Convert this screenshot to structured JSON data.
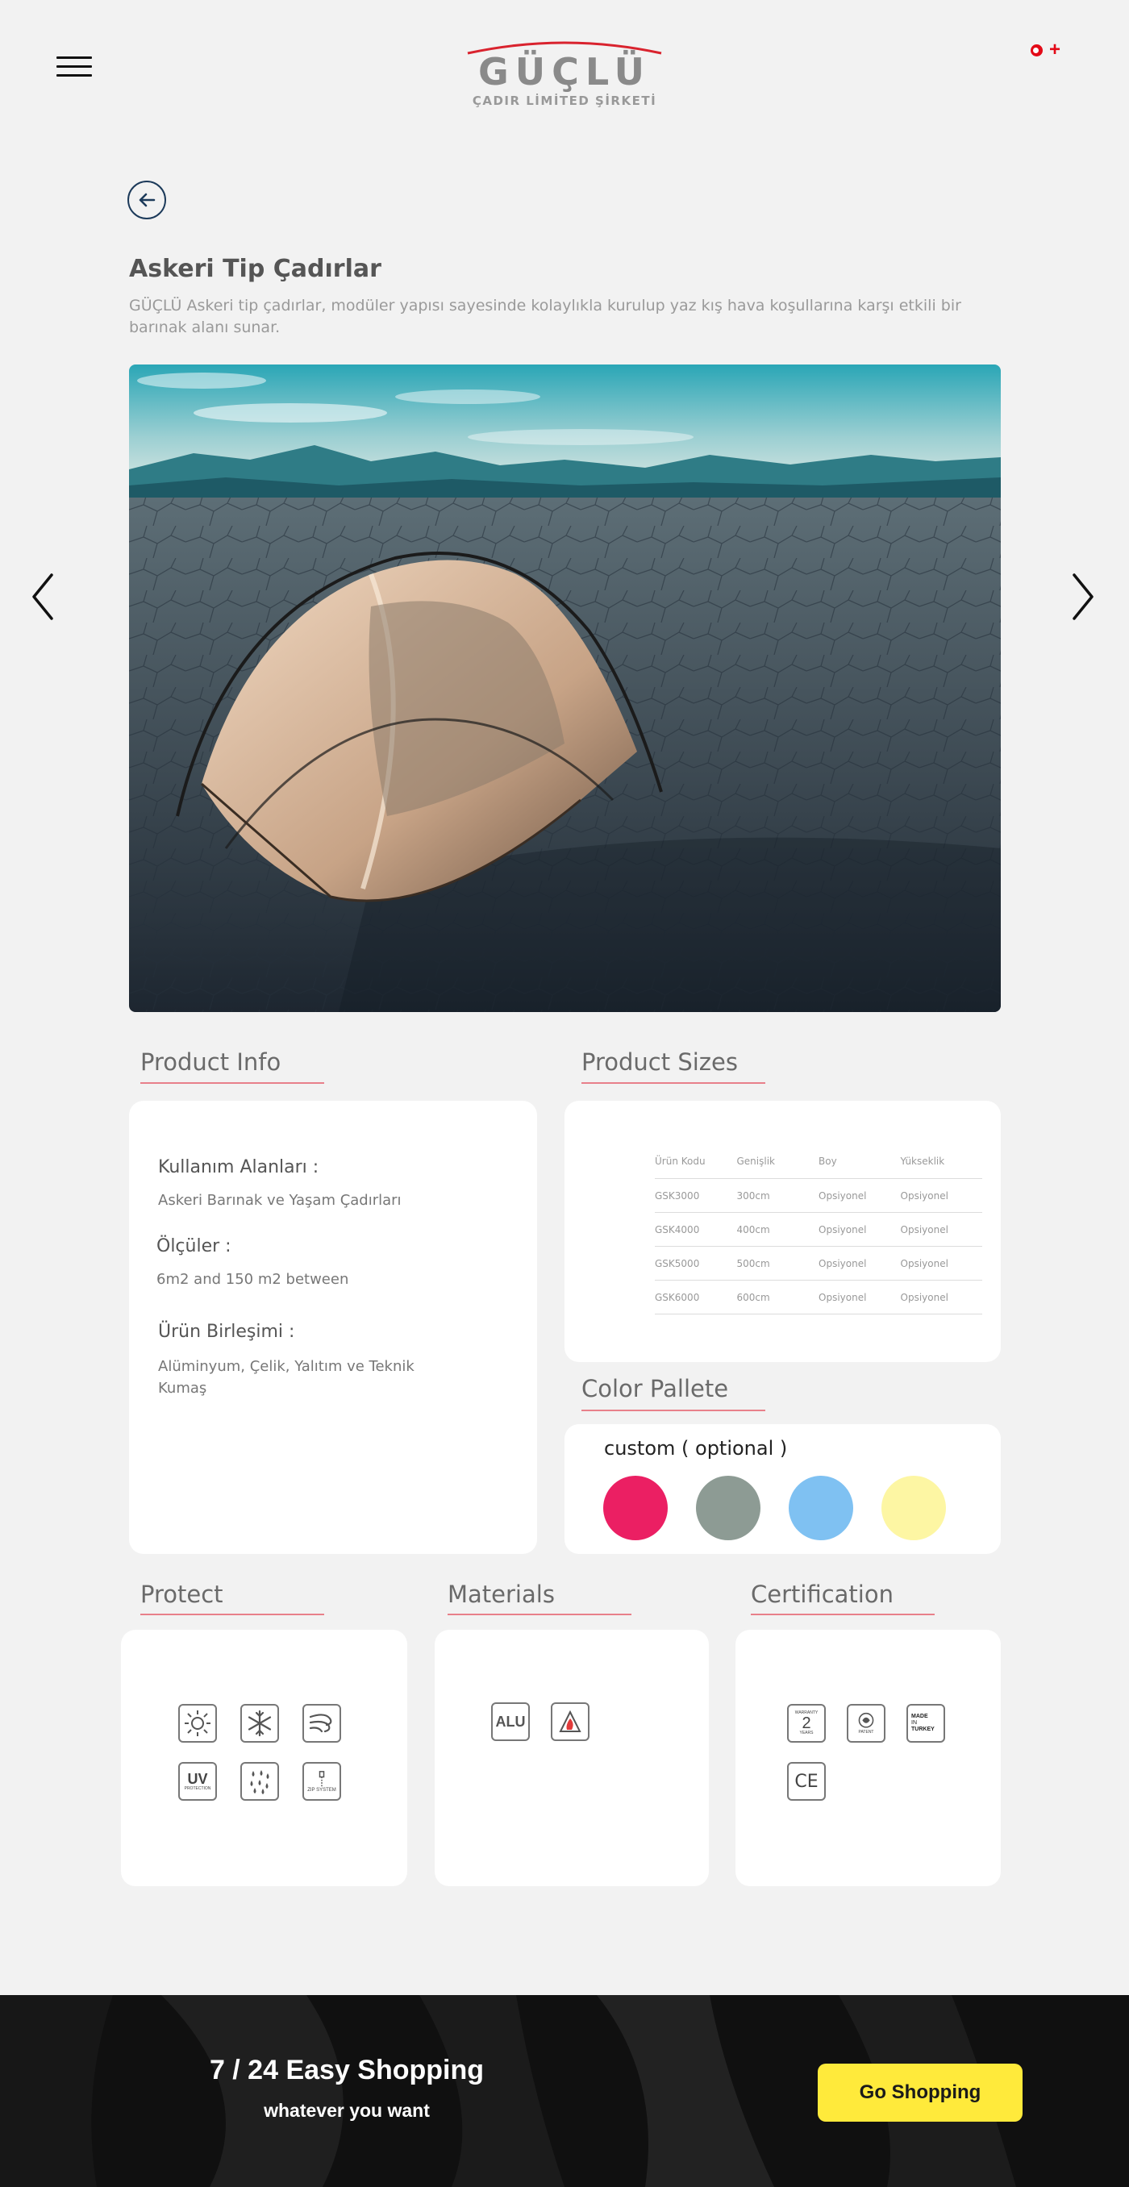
{
  "header": {
    "logo_text": "GÜÇLÜ",
    "logo_subtitle": "ÇADIR LİMİTED ŞİRKETİ"
  },
  "product": {
    "title": "Askeri Tip Çadırlar",
    "description": "GÜÇLÜ Askeri tip çadırlar, modüler yapısı sayesinde kolaylıkla kurulup yaz kış hava koşullarına karşı etkili bir barınak alanı sunar."
  },
  "product_info": {
    "heading": "Product Info",
    "usage_label": "Kullanım Alanları :",
    "usage_value": "Askeri Barınak ve Yaşam Çadırları",
    "size_label": "Ölçüler :",
    "size_value": "6m2 and 150 m2 between",
    "composition_label": "Ürün Birleşimi :",
    "composition_value": "Alüminyum, Çelik, Yalıtım ve Teknik Kumaş"
  },
  "product_sizes": {
    "heading": "Product Sizes",
    "columns": [
      "Ürün Kodu",
      "Genişlik",
      "Boy",
      "Yükseklik"
    ],
    "rows": [
      [
        "GSK3000",
        "300cm",
        "Opsiyonel",
        "Opsiyonel"
      ],
      [
        "GSK4000",
        "400cm",
        "Opsiyonel",
        "Opsiyonel"
      ],
      [
        "GSK5000",
        "500cm",
        "Opsiyonel",
        "Opsiyonel"
      ],
      [
        "GSK6000",
        "600cm",
        "Opsiyonel",
        "Opsiyonel"
      ]
    ]
  },
  "color_palette": {
    "heading": "Color Pallete",
    "caption": "custom ( optional )",
    "colors": [
      "#eb1f63",
      "#8d9b94",
      "#7fc1f2",
      "#fdf6a3"
    ]
  },
  "protect": {
    "heading": "Protect",
    "icons": [
      "sun-icon",
      "snowflake-icon",
      "wind-icon",
      "uv-protection-icon",
      "rain-drops-icon",
      "zip-system-icon"
    ],
    "uv_text": "UV",
    "uv_sub": "PROTECTION",
    "zip_text": "ZIP SYSTEM"
  },
  "materials": {
    "heading": "Materials",
    "icons": [
      "alu-icon",
      "fire-resistant-icon"
    ],
    "alu_text": "ALU"
  },
  "certification": {
    "heading": "Certification",
    "icons": [
      "warranty-2-years-icon",
      "patent-icon",
      "made-in-turkey-icon",
      "ce-mark-icon"
    ],
    "warranty_top": "WARRANTY",
    "warranty_num": "2",
    "warranty_bottom": "YEARS",
    "patent_text": "PATENT",
    "made_in_turkey": [
      "MADE",
      "IN",
      "TURKEY"
    ],
    "ce_text": "CE"
  },
  "banner": {
    "title": "7 / 24 Easy Shopping",
    "subtitle": "whatever you want",
    "button_label": "Go Shopping",
    "button_color": "#ffea3b"
  }
}
